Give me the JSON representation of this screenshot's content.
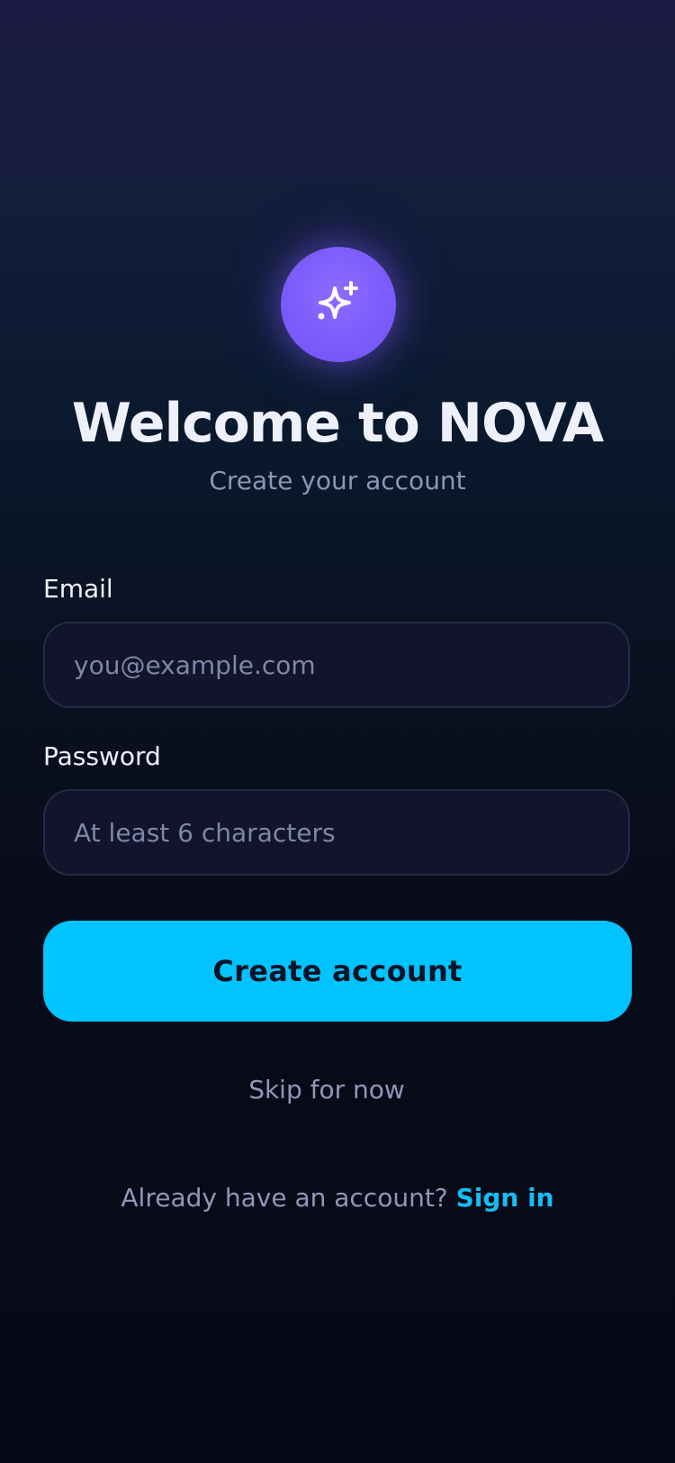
{
  "app": {
    "logo_icon": "sparkle-icon",
    "accent_color": "#7b5bfa",
    "primary_color": "#00c4ff",
    "link_color": "#14bdf5"
  },
  "header": {
    "title": "Welcome to NOVA",
    "subtitle": "Create your account"
  },
  "form": {
    "email_label": "Email",
    "email_placeholder": "you@example.com",
    "email_value": "",
    "password_label": "Password",
    "password_placeholder": "At least 6 characters",
    "password_value": "",
    "submit_label": "Create account"
  },
  "skip_label": "Skip for now",
  "footer": {
    "prompt": "Already have an account?",
    "signin_label": "Sign in"
  }
}
